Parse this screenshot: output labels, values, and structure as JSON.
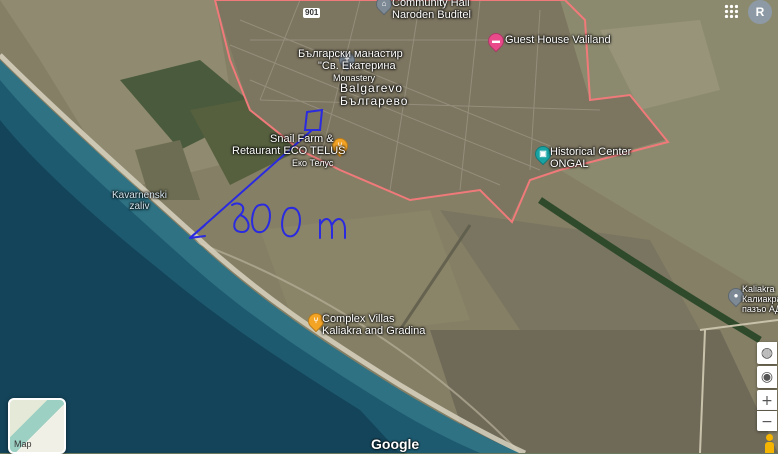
{
  "map": {
    "type": "satellite",
    "provider_logo": "Google",
    "colors": {
      "sea_deep": "#14445a",
      "sea_shallow": "#2f7283",
      "land": "#8a8a6c",
      "fields": "#5f7252",
      "village_boundary": "#f07a7a",
      "annotation_ink": "#2a2ae0",
      "pin_orange": "#f4a425",
      "pin_pink": "#e94b8a",
      "pin_teal": "#1aa3a3",
      "pin_grey": "#7d8a96"
    }
  },
  "labels": {
    "community_hall_1": "Community Hall",
    "community_hall_2": "Naroden Buditel",
    "monastery_1": "Български манастир",
    "monastery_2": "\"Св. Екатерина",
    "monastery_3": "Monastery",
    "town_latin": "Balgarevo",
    "town_cyrillic": "Българево",
    "guest_house": "Guest House Valiland",
    "snail_farm_1": "Snail Farm &",
    "snail_farm_2": "Retaurant ECO TELUS",
    "snail_farm_3": "Еко Телус",
    "historical_1": "Historical Center",
    "historical_2": "ONGAL",
    "bay_1": "Kavarnenski",
    "bay_2": "zaliv",
    "villas_1": "Complex Villas",
    "villas_2": "Kaliakra and Gradina",
    "kaliakra_1": "Kaliakra",
    "kaliakra_2": "Калиакра",
    "kaliakra_3": "пазъо АД",
    "road_shield": "901",
    "watermark": "Google"
  },
  "annotation": {
    "handwritten_distance": "800m"
  },
  "controls": {
    "map_toggle_label": "Map",
    "grid_icon": "apps-grid-icon",
    "account_initial": "R",
    "zoom_in": "+",
    "zoom_out": "−",
    "layers_icon": "globe-icon",
    "street_view_icon": "pegman-icon",
    "location_icon": "my-location-icon"
  }
}
